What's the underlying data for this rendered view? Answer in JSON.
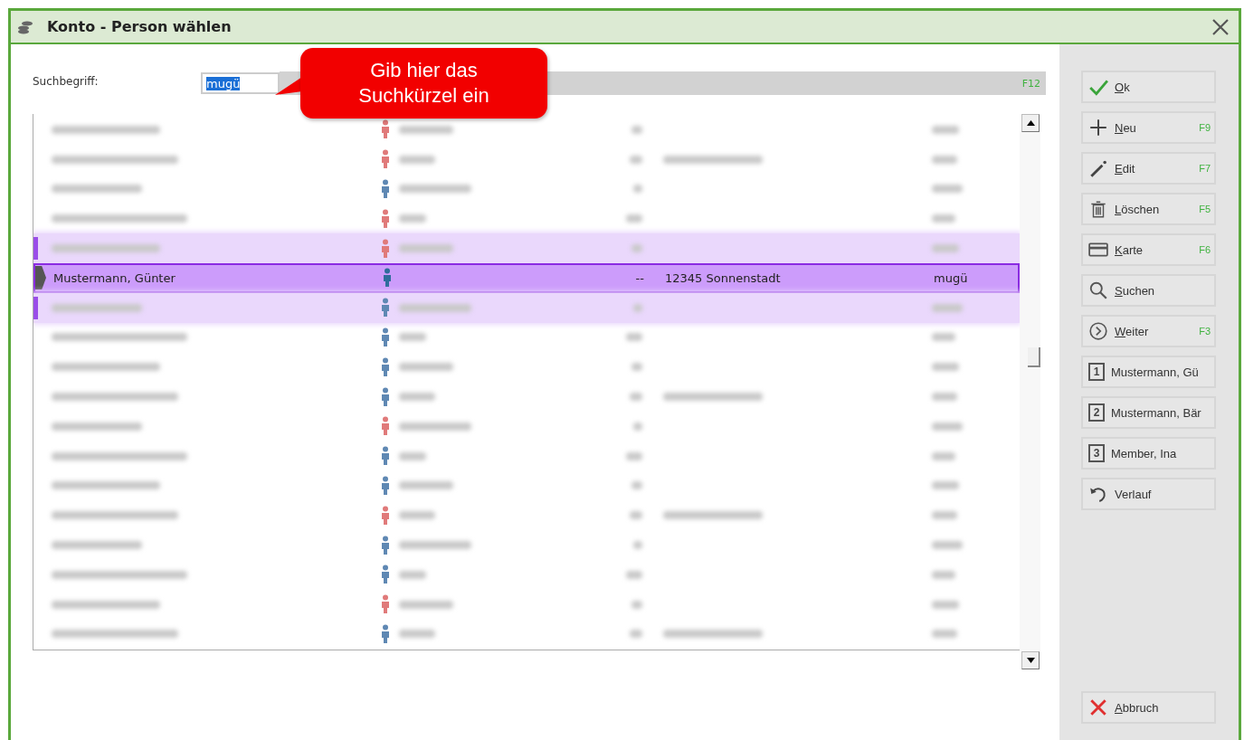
{
  "window": {
    "title": "Konto - Person wählen"
  },
  "search": {
    "label": "Suchbegriff:",
    "value": "mugü",
    "value_selected": true,
    "shortcut": "F12"
  },
  "callout": {
    "text": "Gib hier das Suchkürzel ein"
  },
  "table": {
    "rows": [
      {
        "kind": "blurred",
        "color": "#e07a7a",
        "selected": false,
        "highlighted": false
      },
      {
        "kind": "blurred",
        "color": "#e07a7a",
        "selected": false,
        "highlighted": false
      },
      {
        "kind": "blurred",
        "color": "#5f88b3",
        "selected": false,
        "highlighted": false
      },
      {
        "kind": "blurred",
        "color": "#e07a7a",
        "selected": false,
        "highlighted": false
      },
      {
        "kind": "blurred",
        "color": "#e07a7a",
        "selected": false,
        "highlighted": true
      },
      {
        "kind": "text",
        "color": "#2f6c9c",
        "selected": true,
        "highlighted": false,
        "name": "Mustermann, Günter",
        "column_3": "--",
        "city": "12345 Sonnenstadt",
        "code": "mugü"
      },
      {
        "kind": "blurred",
        "color": "#5f88b3",
        "selected": false,
        "highlighted": true
      },
      {
        "kind": "blurred",
        "color": "#5f88b3",
        "selected": false,
        "highlighted": false
      },
      {
        "kind": "blurred",
        "color": "#5f88b3",
        "selected": false,
        "highlighted": false
      },
      {
        "kind": "blurred",
        "color": "#5f88b3",
        "selected": false,
        "highlighted": false
      },
      {
        "kind": "blurred",
        "color": "#e07a7a",
        "selected": false,
        "highlighted": false
      },
      {
        "kind": "blurred",
        "color": "#5f88b3",
        "selected": false,
        "highlighted": false
      },
      {
        "kind": "blurred",
        "color": "#5f88b3",
        "selected": false,
        "highlighted": false
      },
      {
        "kind": "blurred",
        "color": "#e07a7a",
        "selected": false,
        "highlighted": false
      },
      {
        "kind": "blurred",
        "color": "#5f88b3",
        "selected": false,
        "highlighted": false
      },
      {
        "kind": "blurred",
        "color": "#5f88b3",
        "selected": false,
        "highlighted": false
      },
      {
        "kind": "blurred",
        "color": "#e07a7a",
        "selected": false,
        "highlighted": false
      },
      {
        "kind": "blurred",
        "color": "#5f88b3",
        "selected": false,
        "highlighted": false
      }
    ]
  },
  "buttons": [
    {
      "kind": "ok",
      "label": "Ok",
      "mnemonic": true
    },
    {
      "kind": "new",
      "label": "Neu",
      "mnemonic": true,
      "shortcut": "F9"
    },
    {
      "kind": "edit",
      "label": "Edit",
      "mnemonic": true,
      "shortcut": "F7"
    },
    {
      "kind": "delete",
      "label": "Löschen",
      "mnemonic": true,
      "shortcut": "F5"
    },
    {
      "kind": "card",
      "label": "Karte",
      "mnemonic": true,
      "shortcut": "F6"
    },
    {
      "kind": "search",
      "label": "Suchen",
      "mnemonic": true
    },
    {
      "kind": "next",
      "label": "Weiter",
      "mnemonic": true,
      "shortcut": "F3"
    },
    {
      "kind": "recent",
      "number": "1",
      "label": "Mustermann, Gü",
      "mnemonic": false
    },
    {
      "kind": "recent",
      "number": "2",
      "label": "Mustermann, Bär",
      "mnemonic": false
    },
    {
      "kind": "recent",
      "number": "3",
      "label": "Member, Ina",
      "mnemonic": false
    },
    {
      "kind": "history",
      "label": "Verlauf",
      "mnemonic": false
    }
  ],
  "cancel_button": {
    "kind": "cancel",
    "label": "Abbruch",
    "mnemonic": true
  }
}
